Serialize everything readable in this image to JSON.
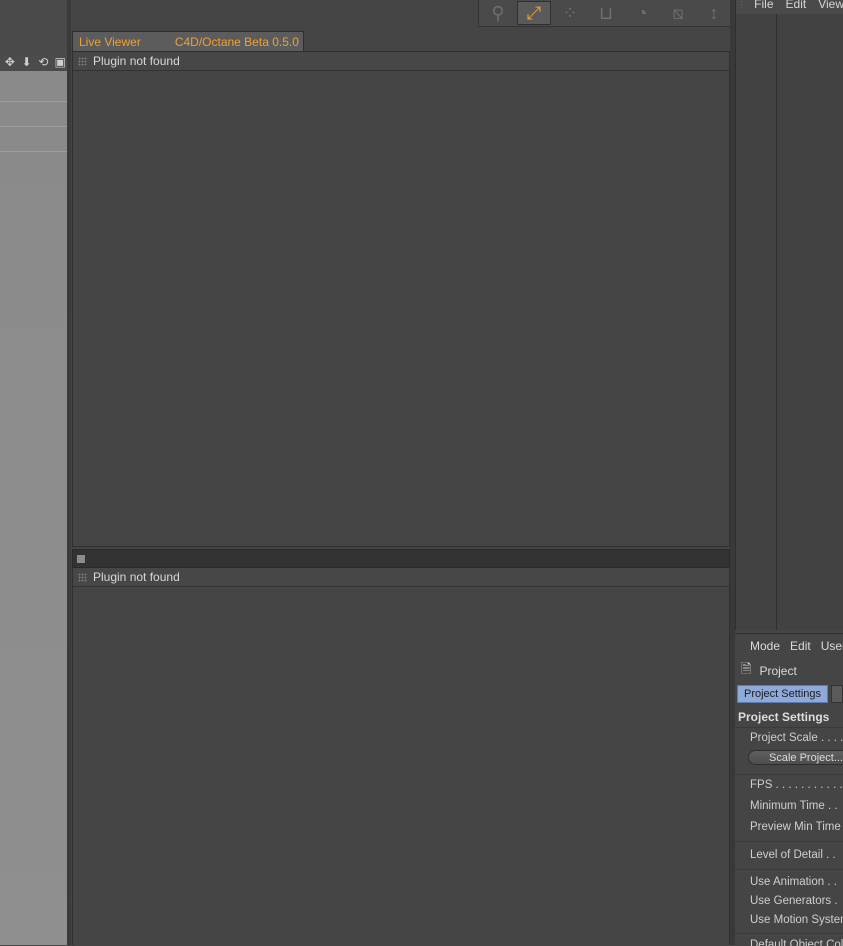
{
  "live_viewer_tab": {
    "title": "Live Viewer",
    "subtitle": "C4D/Octane Beta 0.5.0"
  },
  "viewers": {
    "top_message": "Plugin not found",
    "bottom_message": "Plugin not found"
  },
  "left_toolbar": {
    "icons": [
      "move-icon",
      "down-arrow-icon",
      "reset-icon",
      "window-icon"
    ]
  },
  "top_toolbar": {
    "icons": [
      "render-sphere-icon",
      "axis-icon",
      "grid-dots-icon",
      "deformer-icon",
      "shape-icon",
      "scene-icon",
      "coordinates-icon"
    ],
    "active_index": 1
  },
  "object_manager": {
    "menu": [
      "File",
      "Edit",
      "View"
    ]
  },
  "attribute_manager": {
    "menu": [
      "Mode",
      "Edit",
      "User Data"
    ],
    "context": "Project",
    "active_tab": "Project Settings",
    "section_title": "Project Settings",
    "scale_button": "Scale Project...",
    "rows": {
      "project_scale": "Project Scale . . . .",
      "fps": "FPS . . . . . . . . . . . .",
      "minimum_time": "Minimum Time . .",
      "preview_min_time": "Preview Min Time",
      "level_of_detail": "Level of Detail  . .",
      "use_animation": "Use Animation . .",
      "use_generators": "Use Generators  .",
      "use_motion_system": "Use Motion System",
      "default_object_color": "Default Object Color"
    }
  },
  "colors": {
    "accent": "#f0a030",
    "tab_active": "#8fa9d8",
    "background": "#454545"
  }
}
